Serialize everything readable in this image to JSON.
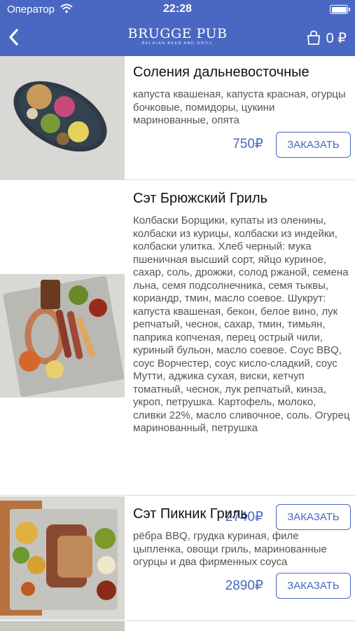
{
  "status_bar": {
    "carrier": "Оператор",
    "time": "22:28"
  },
  "nav": {
    "logo_title": "BRUGGE PUB",
    "logo_subtitle": "BELGIAN BEER AND GRILL",
    "cart_total": "0 ₽"
  },
  "items": [
    {
      "name": "Соления дальневосточные",
      "description": "капуста квашеная, капуста красная, огурцы бочковые, помидоры, цукини маринованные, опята",
      "price": "750₽",
      "order_label": "ЗАКАЗАТЬ"
    },
    {
      "name": "Сэт Брюжский Гриль",
      "description": "Колбаски Борщики, купаты из оленины, колбаски из курицы, колбаски из индейки, колбаски улитка. Хлеб черный: мука пшеничная высший сорт, яйцо куриное, сахар, соль, дрожжи, солод ржаной, семена льна, семя подсолнечника, семя тыквы, кориандр, тмин, масло соевое. Шукрут: капуста квашеная, бекон, белое вино, лук репчатый, чеснок, сахар, тмин, тимьян, паприка копченая, перец острый чили, куриный бульон, масло соевое. Соус BBQ, соус Ворчестер, соус кисло-сладкий, соус Мутти, аджика сухая, виски, кетчуп томатный, чеснок, лук репчатый, кинза, укроп, петрушка. Картофель, молоко, сливки 22%, масло сливочное, соль. Огурец маринованный, петрушка",
      "price": "2740₽",
      "order_label": "ЗАКАЗАТЬ"
    },
    {
      "name": "Сэт Пикник Гриль",
      "description": "рёбра BBQ, грудка куриная, филе цыпленка, овощи гриль, маринованные огурцы и два фирменных соуса",
      "price": "2890₽",
      "order_label": "ЗАКАЗАТЬ"
    }
  ],
  "icons": [
    "wifi-icon",
    "battery-icon",
    "back-chevron-icon",
    "shopping-bag-icon"
  ],
  "colors": {
    "accent": "#4a68c1",
    "header_bg": "#4a68c1",
    "text": "#111111",
    "description": "#555555"
  }
}
